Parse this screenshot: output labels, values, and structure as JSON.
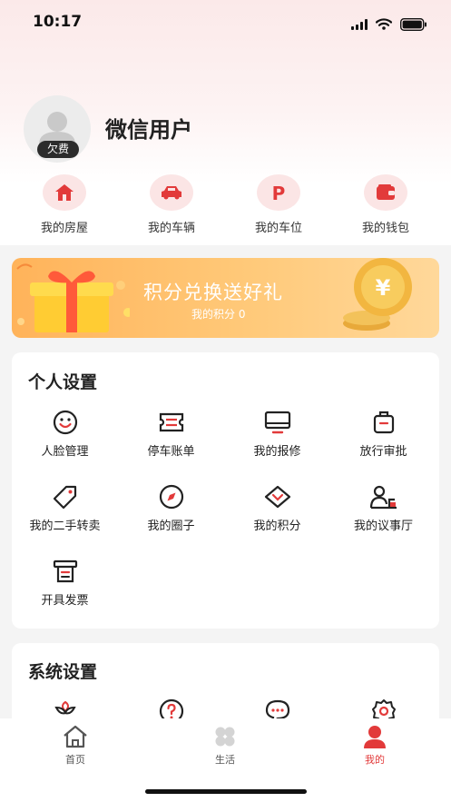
{
  "status_bar": {
    "time": "10:17",
    "icons": [
      "signal-icon",
      "wifi-icon",
      "battery-icon"
    ]
  },
  "profile": {
    "username": "微信用户",
    "badge": "欠费",
    "avatar_icon": "person-icon"
  },
  "quick_actions": [
    {
      "label": "我的房屋",
      "icon": "house-icon"
    },
    {
      "label": "我的车辆",
      "icon": "car-icon"
    },
    {
      "label": "我的车位",
      "icon": "parking-icon"
    },
    {
      "label": "我的钱包",
      "icon": "wallet-icon"
    }
  ],
  "banner": {
    "title": "积分兑换送好礼",
    "subtitle": "我的积分 0",
    "icons": [
      "gift-icon",
      "coin-icon"
    ]
  },
  "personal_settings": {
    "title": "个人设置",
    "items": [
      {
        "label": "人脸管理",
        "icon": "face-icon"
      },
      {
        "label": "停车账单",
        "icon": "ticket-icon"
      },
      {
        "label": "我的报修",
        "icon": "monitor-icon"
      },
      {
        "label": "放行审批",
        "icon": "luggage-icon"
      },
      {
        "label": "我的二手转卖",
        "icon": "tag-icon"
      },
      {
        "label": "我的圈子",
        "icon": "compass-icon"
      },
      {
        "label": "我的积分",
        "icon": "points-icon"
      },
      {
        "label": "我的议事厅",
        "icon": "meeting-icon"
      },
      {
        "label": "开具发票",
        "icon": "invoice-icon"
      }
    ]
  },
  "system_settings": {
    "title": "系统设置",
    "items": [
      {
        "icon": "flower-icon"
      },
      {
        "icon": "help-icon"
      },
      {
        "icon": "chat-icon"
      },
      {
        "icon": "settings-gear-icon"
      }
    ]
  },
  "tabbar": {
    "tabs": [
      {
        "label": "首页",
        "icon": "home-icon",
        "active": false
      },
      {
        "label": "生活",
        "icon": "clover-icon",
        "active": false
      },
      {
        "label": "我的",
        "icon": "user-icon",
        "active": true
      }
    ]
  },
  "colors": {
    "accent": "#e23a3a",
    "icon_tint": "#fbe5e5",
    "banner": "#ffb35a"
  }
}
